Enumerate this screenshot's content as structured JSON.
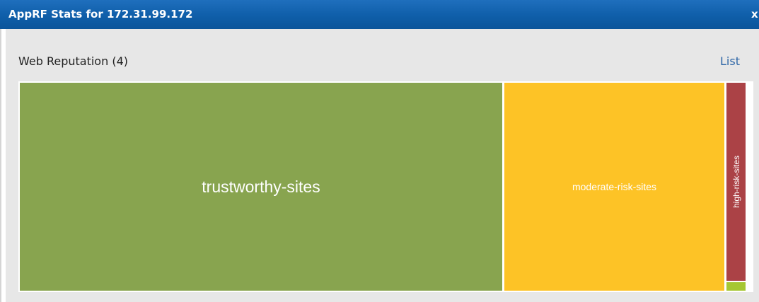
{
  "window": {
    "title": "AppRF Stats for 172.31.99.172",
    "close_label": "x"
  },
  "panel": {
    "title": "Web Reputation (4)",
    "list_link": "List"
  },
  "treemap": {
    "tiles": [
      {
        "label": "trustworthy-sites",
        "color": "#88a44f"
      },
      {
        "label": "moderate-risk-sites",
        "color": "#fdc326"
      },
      {
        "label": "high-risk-sites",
        "color": "#ab4246"
      },
      {
        "label": "",
        "color": "#a6c733"
      }
    ]
  }
}
